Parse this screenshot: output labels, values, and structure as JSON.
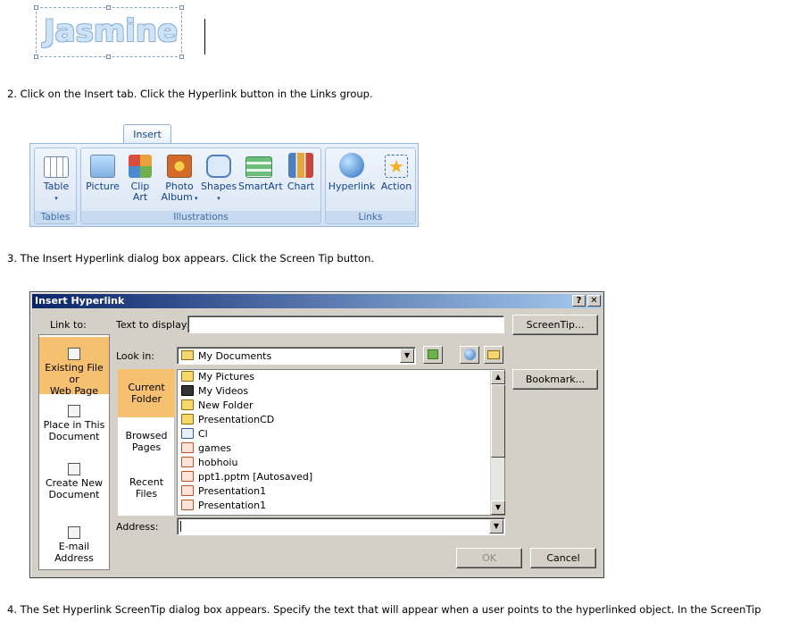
{
  "wordart": {
    "text": "Jasmine"
  },
  "steps": [
    {
      "text": "2.   Click on the Insert tab. Click the Hyperlink button in the Links group."
    },
    {
      "text": "3.   The Insert Hyperlink dialog box appears. Click the Screen Tip button."
    },
    {
      "text": "4.   The Set Hyperlink ScreenTip dialog box appears. Specify the text that will appear when a user points to the hyperlinked object. In the ScreenTip"
    }
  ],
  "ribbon": {
    "tab_label": "Insert",
    "groups": {
      "tables": {
        "label": "Tables",
        "buttons": {
          "table": "Table"
        }
      },
      "illustrations": {
        "label": "Illustrations",
        "buttons": {
          "picture": "Picture",
          "clip_art_1": "Clip",
          "clip_art_2": "Art",
          "photo_album_1": "Photo",
          "photo_album_2": "Album",
          "shapes": "Shapes",
          "smartart": "SmartArt",
          "chart": "Chart"
        }
      },
      "links": {
        "label": "Links",
        "buttons": {
          "hyperlink": "Hyperlink",
          "action": "Action"
        }
      }
    }
  },
  "dialog": {
    "title": "Insert Hyperlink",
    "title_help": "?",
    "title_close": "✕",
    "link_to_label": "Link to:",
    "text_to_display_label": "Text to display:",
    "text_to_display_value": "",
    "screentip_button": "ScreenTip...",
    "look_in_label": "Look in:",
    "look_in_value": "My Documents",
    "bookmark_button": "Bookmark...",
    "link_to_items": {
      "existing_1": "Existing File or",
      "existing_2": "Web Page",
      "place_1": "Place in This",
      "place_2": "Document",
      "create_1": "Create New",
      "create_2": "Document",
      "email": "E-mail Address"
    },
    "nav": {
      "current_1": "Current",
      "current_2": "Folder",
      "browsed_1": "Browsed",
      "browsed_2": "Pages",
      "recent_1": "Recent",
      "recent_2": "Files"
    },
    "files": [
      {
        "name": "My Pictures",
        "icon": "pictures-folder-icon"
      },
      {
        "name": "My Videos",
        "icon": "videos-folder-icon"
      },
      {
        "name": "New Folder",
        "icon": "folder-icon"
      },
      {
        "name": "PresentationCD",
        "icon": "folder-icon"
      },
      {
        "name": "Cl",
        "icon": "word-doc-icon"
      },
      {
        "name": "games",
        "icon": "ppt-file-icon"
      },
      {
        "name": "hobhoiu",
        "icon": "ppt-file-icon"
      },
      {
        "name": "ppt1.pptm [Autosaved]",
        "icon": "ppt-file-icon"
      },
      {
        "name": "Presentation1",
        "icon": "ppt-file-icon"
      },
      {
        "name": "Presentation1",
        "icon": "ppt-file-icon"
      }
    ],
    "address_label": "Address:",
    "address_value": "",
    "ok_button": "OK",
    "cancel_button": "Cancel"
  }
}
